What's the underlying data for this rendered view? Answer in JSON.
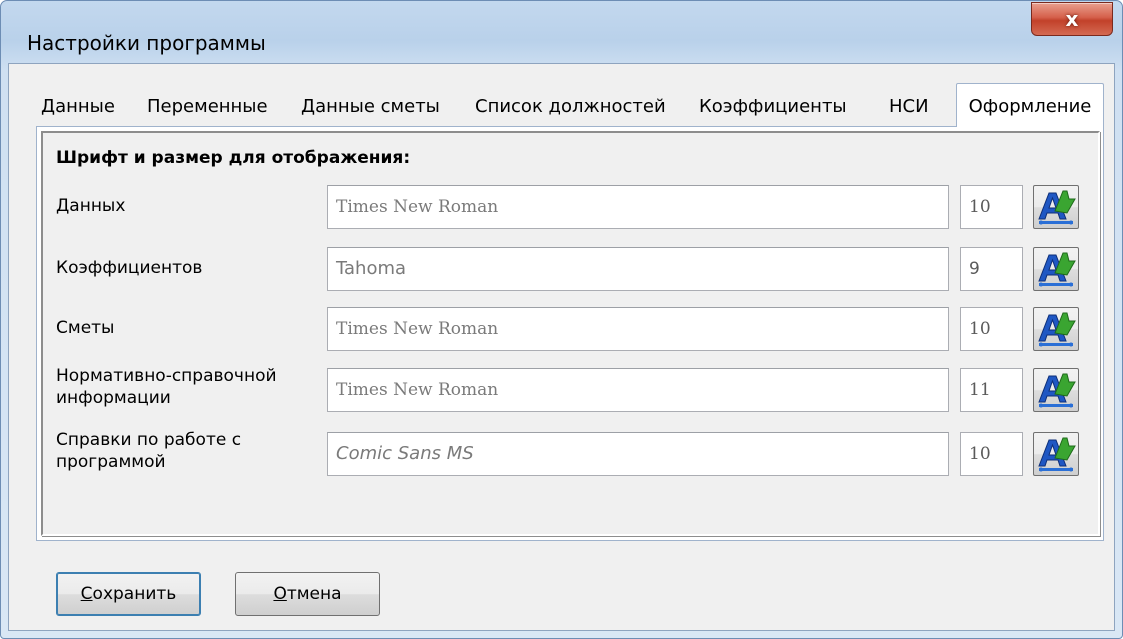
{
  "window": {
    "title": "Настройки программы",
    "close_label": "x"
  },
  "tabs": [
    {
      "label": "Данные",
      "active": false
    },
    {
      "label": "Переменные",
      "active": false
    },
    {
      "label": "Данные сметы",
      "active": false
    },
    {
      "label": "Список должностей",
      "active": false
    },
    {
      "label": "Коэффициенты",
      "active": false
    },
    {
      "label": "НСИ",
      "active": false
    },
    {
      "label": "Оформление",
      "active": true
    }
  ],
  "panel": {
    "heading": "Шрифт и размер для отображения:",
    "rows": [
      {
        "label": "Данных",
        "font": "Times New Roman",
        "size": "10"
      },
      {
        "label": "Коэффициентов",
        "font": "Tahoma",
        "size": "9"
      },
      {
        "label": "Сметы",
        "font": "Times New Roman",
        "size": "10"
      },
      {
        "label_line1": "Нормативно-справочной",
        "label_line2": "информации",
        "font": "Times New Roman",
        "size": "11"
      },
      {
        "label_line1": "Справки по работе с",
        "label_line2": "программой",
        "font": "Comic Sans MS",
        "size": "10"
      }
    ],
    "font_picker_icon": "font-color-picker-icon"
  },
  "buttons": {
    "save_first": "С",
    "save_rest": "охранить",
    "cancel_first": "О",
    "cancel_rest": "тмена"
  },
  "colors": {
    "title_bar": "#b9d1ea",
    "close_button": "#c2412a",
    "panel_background": "#f0f0f0",
    "icon_blue": "#1f57c3",
    "icon_green": "#3aa531"
  }
}
